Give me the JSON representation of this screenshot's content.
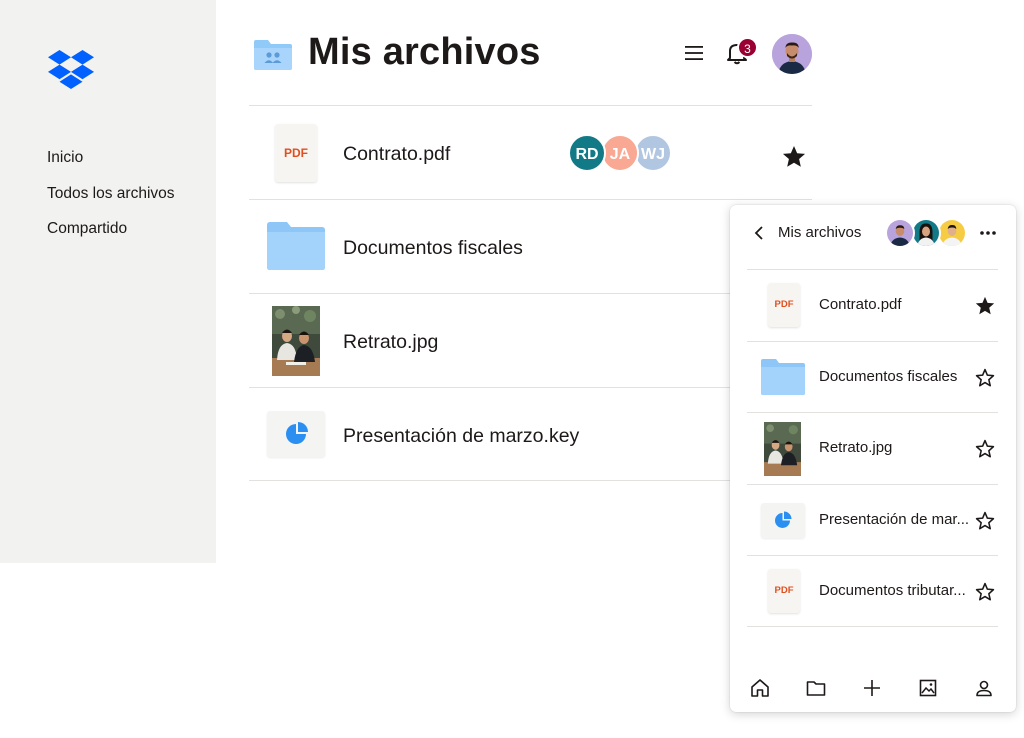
{
  "sidebar": {
    "logo_icon": "dropbox-logo-icon",
    "nav": [
      {
        "label": "Inicio"
      },
      {
        "label": "Todos los archivos"
      },
      {
        "label": "Compartido"
      }
    ]
  },
  "header": {
    "title": "Mis archivos",
    "notification_count": "3",
    "colors": {
      "accent": "#0061fe",
      "badge": "#9b0032"
    }
  },
  "files": [
    {
      "name": "Contrato.pdf",
      "icon": "pdf-icon",
      "pdf_label": "PDF",
      "starred": true,
      "collaborators": [
        {
          "initials": "RD",
          "color": "#127a87"
        },
        {
          "initials": "JA",
          "color": "#f9a893"
        },
        {
          "initials": "WJ",
          "color": "#b1c6e0"
        }
      ]
    },
    {
      "name": "Documentos fiscales",
      "icon": "folder-icon",
      "starred": false
    },
    {
      "name": "Retrato.jpg",
      "icon": "photo-thumbnail",
      "starred": false
    },
    {
      "name": "Presentación de marzo.key",
      "icon": "keynote-pie-icon",
      "starred": false
    }
  ],
  "mobile": {
    "title": "Mis archivos",
    "files": [
      {
        "name": "Contrato.pdf",
        "icon": "pdf-icon",
        "pdf_label": "PDF",
        "starred": true
      },
      {
        "name": "Documentos fiscales",
        "icon": "folder-icon",
        "starred": false
      },
      {
        "name": "Retrato.jpg",
        "icon": "photo-thumbnail",
        "starred": false
      },
      {
        "name": "Presentación de mar...",
        "icon": "keynote-pie-icon",
        "starred": false
      },
      {
        "name": "Documentos tributar...",
        "icon": "pdf-icon",
        "pdf_label": "PDF",
        "starred": false
      }
    ],
    "tabbar": [
      "home-icon",
      "folder-icon",
      "plus-icon",
      "photos-icon",
      "account-icon"
    ]
  }
}
